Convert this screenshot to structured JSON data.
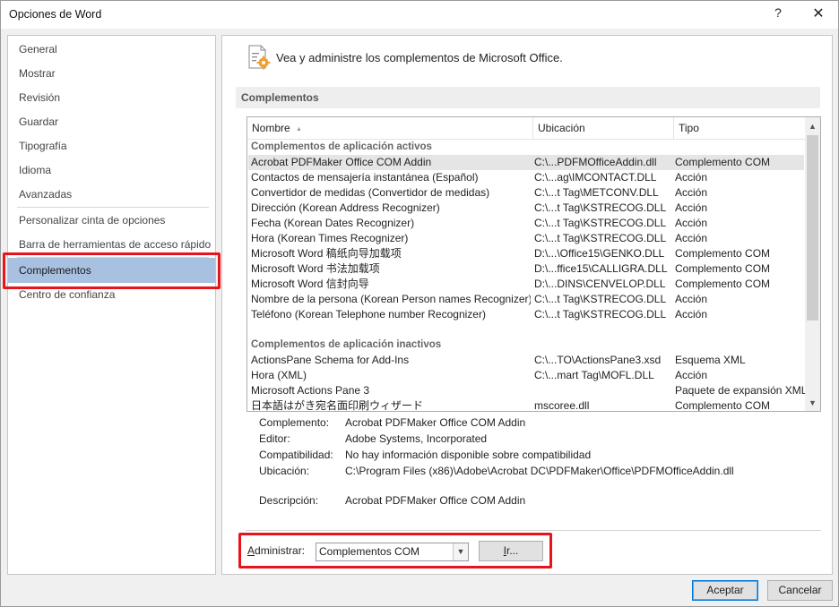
{
  "window": {
    "title": "Opciones de Word",
    "help_glyph": "?",
    "close_glyph": "✕"
  },
  "nav": {
    "items": [
      {
        "label": "General"
      },
      {
        "label": "Mostrar"
      },
      {
        "label": "Revisión"
      },
      {
        "label": "Guardar"
      },
      {
        "label": "Tipografía"
      },
      {
        "label": "Idioma"
      },
      {
        "label": "Avanzadas"
      },
      {
        "label": "Personalizar cinta de opciones"
      },
      {
        "label": "Barra de herramientas de acceso rápido"
      },
      {
        "label": "Complementos"
      },
      {
        "label": "Centro de confianza"
      }
    ],
    "selected": "Complementos"
  },
  "header": {
    "icon": "addins-gear-icon",
    "text": "Vea y administre los complementos de Microsoft Office."
  },
  "section": {
    "title": "Complementos"
  },
  "table": {
    "columns": [
      "Nombre",
      "Ubicación",
      "Tipo"
    ],
    "sort_indicator": "▲",
    "groups": [
      {
        "title": "Complementos de aplicación activos",
        "rows": [
          {
            "name": "Acrobat PDFMaker Office COM Addin",
            "location": "C:\\...PDFMOfficeAddin.dll",
            "type": "Complemento COM"
          },
          {
            "name": "Contactos de mensajería instantánea (Español)",
            "location": "C:\\...ag\\IMCONTACT.DLL",
            "type": "Acción"
          },
          {
            "name": "Convertidor de medidas (Convertidor de medidas)",
            "location": "C:\\...t Tag\\METCONV.DLL",
            "type": "Acción"
          },
          {
            "name": "Dirección (Korean Address Recognizer)",
            "location": "C:\\...t Tag\\KSTRECOG.DLL",
            "type": "Acción"
          },
          {
            "name": "Fecha (Korean Dates Recognizer)",
            "location": "C:\\...t Tag\\KSTRECOG.DLL",
            "type": "Acción"
          },
          {
            "name": "Hora (Korean Times Recognizer)",
            "location": "C:\\...t Tag\\KSTRECOG.DLL",
            "type": "Acción"
          },
          {
            "name": "Microsoft Word 稿纸向导加载项",
            "location": "D:\\...\\Office15\\GENKO.DLL",
            "type": "Complemento COM"
          },
          {
            "name": "Microsoft Word 书法加载项",
            "location": "D:\\...ffice15\\CALLIGRA.DLL",
            "type": "Complemento COM"
          },
          {
            "name": "Microsoft Word 信封向导",
            "location": "D:\\...DINS\\CENVELOP.DLL",
            "type": "Complemento COM"
          },
          {
            "name": "Nombre de la persona (Korean Person names Recognizer)",
            "location": "C:\\...t Tag\\KSTRECOG.DLL",
            "type": "Acción"
          },
          {
            "name": "Teléfono (Korean Telephone number Recognizer)",
            "location": "C:\\...t Tag\\KSTRECOG.DLL",
            "type": "Acción"
          }
        ]
      },
      {
        "title": "Complementos de aplicación inactivos",
        "rows": [
          {
            "name": "ActionsPane Schema for Add-Ins",
            "location": "C:\\...TO\\ActionsPane3.xsd",
            "type": "Esquema XML"
          },
          {
            "name": "Hora (XML)",
            "location": "C:\\...mart Tag\\MOFL.DLL",
            "type": "Acción"
          },
          {
            "name": "Microsoft Actions Pane 3",
            "location": "",
            "type": "Paquete de expansión XML"
          },
          {
            "name": "日本語はがき宛名面印刷ウィザード",
            "location": "mscoree.dll",
            "type": "Complemento COM"
          }
        ]
      }
    ],
    "selected_row": "Acrobat PDFMaker Office COM Addin"
  },
  "details": {
    "complemento_label": "Complemento:",
    "complemento": "Acrobat PDFMaker Office COM Addin",
    "editor_label": "Editor:",
    "editor": "Adobe Systems, Incorporated",
    "compat_label": "Compatibilidad:",
    "compat": "No hay información disponible sobre compatibilidad",
    "ubicacion_label": "Ubicación:",
    "ubicacion": "C:\\Program Files (x86)\\Adobe\\Acrobat DC\\PDFMaker\\Office\\PDFMOfficeAddin.dll",
    "descripcion_label": "Descripción:",
    "descripcion": "Acrobat PDFMaker Office COM Addin"
  },
  "manage": {
    "label_underlined": "A",
    "label_rest": "dministrar:",
    "select_value": "Complementos COM",
    "go_underlined": "I",
    "go_rest": "r..."
  },
  "footer": {
    "accept": "Aceptar",
    "cancel": "Cancelar"
  },
  "colors": {
    "highlight": "#e8141b",
    "nav_selected": "#a9c1e0",
    "accent": "#0078d7"
  }
}
